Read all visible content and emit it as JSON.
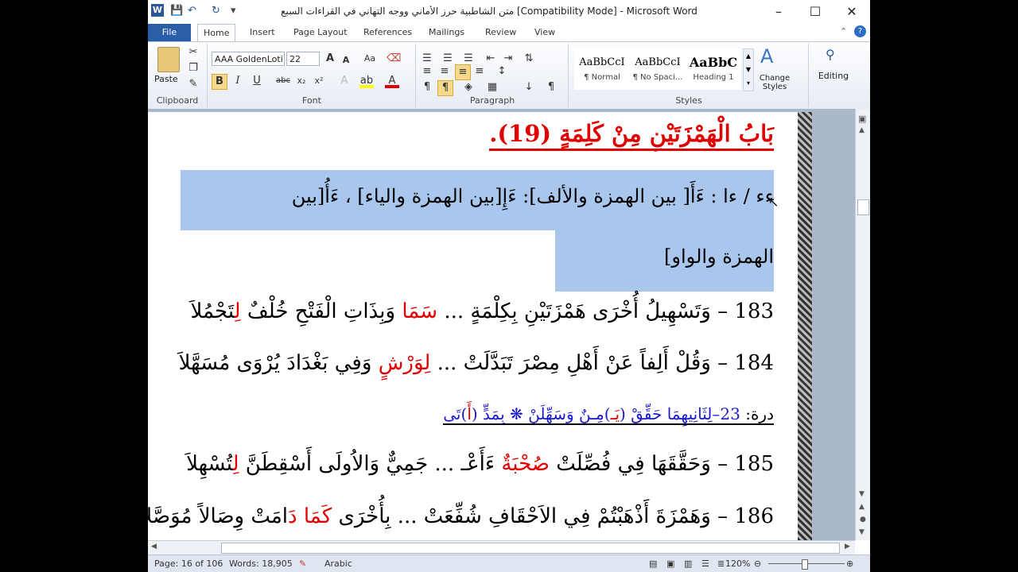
{
  "window": {
    "title": "متن الشاطبية حرز الأماني ووجه التهاني في القراءات السبع [Compatibility Mode]  -  Microsoft Word",
    "minimize": "–",
    "maximize": "☐",
    "close": "✕"
  },
  "qat": {
    "word_icon": "W",
    "save_icon": "💾",
    "undo_icon": "↶",
    "redo_icon": "↻",
    "customize_icon": "▾"
  },
  "tabs": [
    {
      "label": "File"
    },
    {
      "label": "Home"
    },
    {
      "label": "Insert"
    },
    {
      "label": "Page Layout"
    },
    {
      "label": "References"
    },
    {
      "label": "Mailings"
    },
    {
      "label": "Review"
    },
    {
      "label": "View"
    }
  ],
  "ribbon": {
    "clipboard": {
      "label": "Clipboard",
      "paste": "Paste"
    },
    "font": {
      "label": "Font",
      "name": "AAA GoldenLoti",
      "size": "22",
      "bold": "B",
      "italic": "I",
      "underline": "U",
      "strike": "abc",
      "sub": "x₂",
      "sup": "x²"
    },
    "paragraph": {
      "label": "Paragraph"
    },
    "styles": {
      "label": "Styles",
      "items": [
        {
          "sample": "AaBbCcI",
          "name": "¶ Normal"
        },
        {
          "sample": "AaBbCcI",
          "name": "¶ No Spaci..."
        },
        {
          "sample": "AaBbC",
          "name": "Heading 1"
        }
      ],
      "change_styles": "Change Styles"
    },
    "editing": {
      "label": "Editing"
    }
  },
  "document": {
    "heading_text": "بَابُ الْهَمْزَتَيْنِ مِنْ كَلِمَةٍ ",
    "heading_num": "(19).",
    "note_line1": "ءء / ءا : ءَأَ[ بين الهمزة والألف]: ءَإِ[بين الهمزة والياء] ، ءَأُ[بين",
    "note_line2": "الهمزة والواو]",
    "v183_num": "183 – ",
    "v183_a": "وَتَسْهِيلُ أُخْرَى هَمْزَتَيْنِ بِكِلْمَةٍ ... ",
    "v183_red": "سَمَا",
    "v183_b": " وَبِذَاتِ الْفَتْحِ خُلْفٌ ",
    "v183_red2": "لِ",
    "v183_c": "تَجْمُلاَ",
    "v184_num": "184 – ",
    "v184_a": "وَقُلْ أَلِفاً عَنْ أَهْلِ مِصْرَ تَبَدَّلَتْ ... ",
    "v184_red": "لِوَرْشٍ",
    "v184_b": " وَفِي بَغْدَادَ يُرْوَى مُسَهَّلاَ",
    "durra_label": "درة: ",
    "durra_num": "23",
    "durra_a": "–لِثَانِيهِمَا حَقِّقْ (",
    "durra_red1": "يَـ",
    "durra_b": ")مِـنٌ وَسَهِّلَنْ ❋ بِمَدٍّ (",
    "durra_red2": "أَ",
    "durra_c": ")تَى",
    "v185_num": "185 – ",
    "v185_a": "وَحَقَّقَهَا فِي فُصِّلَتْ ",
    "v185_red": "صُحْبَةٌ",
    "v185_b": " ءَأَعْـ ... جَمِيٌّ وَالاُولَى أَسْقِطَنَّ ",
    "v185_red2": "لِ",
    "v185_c": "تُسْهِلاَ",
    "v186_num": "186 – ",
    "v186_a": "وَهَمْزَةَ أَذْهَبْتُمْ فِي الاَحْقَافِ شُفِّعَتْ ... بِأُخْرَى ",
    "v186_red": "كَمَا",
    "v186_b": " ",
    "v186_red2": "دَ",
    "v186_c": "امَتْ وِصَالاً مُوَصَّلاَ"
  },
  "status": {
    "page": "Page: 16 of 106",
    "words": "Words: 18,905",
    "language": "Arabic",
    "zoom": "120%"
  },
  "colors": {
    "accent": "#2a5ea8",
    "highlight": "#a9c6ec",
    "red_text": "#e00000",
    "blue_text": "#1a1acc"
  }
}
